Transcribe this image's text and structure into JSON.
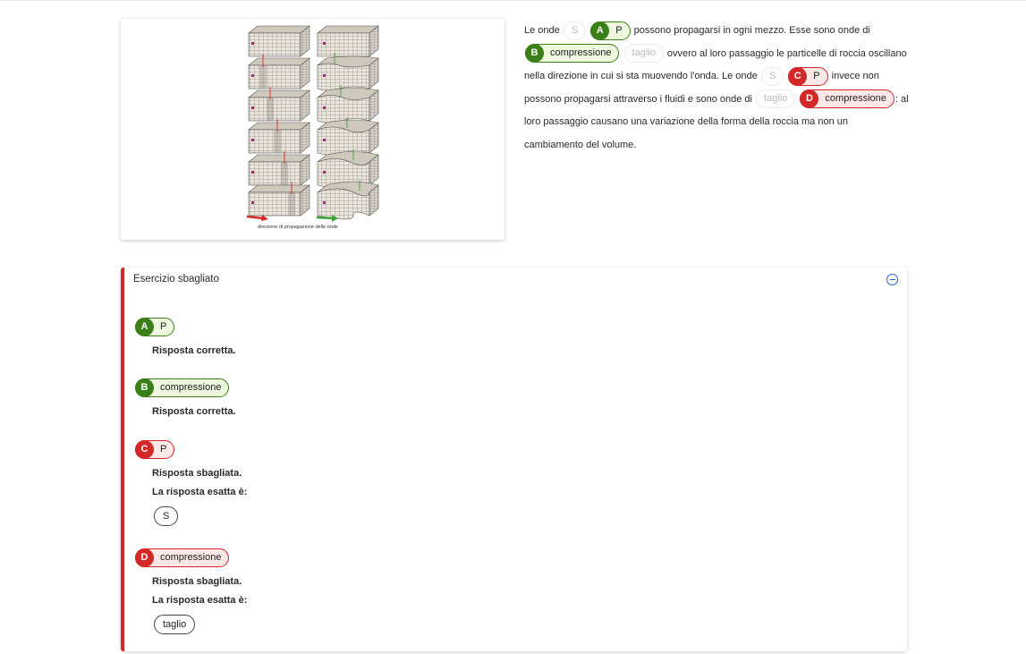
{
  "figure": {
    "caption": "direzione di propagazione delle onde",
    "colors": {
      "p_arrow": "#d42727",
      "s_arrow": "#3aa43a",
      "marker": "#c0188c"
    }
  },
  "paragraph": {
    "t1": "Le onde",
    "t2": "possono propagarsi in ogni mezzo. Esse sono onde di",
    "t3": "ovvero al loro passaggio le particelle di roccia oscillano nella direzione in cui si sta muovendo l'onda. Le onde",
    "t4": "invece non possono propagarsi attraverso i fluidi e sono onde di",
    "t5": ": al loro passaggio causano una variazione della forma della roccia ma non un cambiamento del volume.",
    "opt_s1": "S",
    "opt_taglio1": "taglio",
    "opt_s2": "S",
    "opt_taglio2": "taglio"
  },
  "answers": {
    "A": {
      "letter": "A",
      "value": "P",
      "status": "correct"
    },
    "B": {
      "letter": "B",
      "value": "compressione",
      "status": "correct"
    },
    "C": {
      "letter": "C",
      "value": "P",
      "status": "wrong",
      "correct_value": "S"
    },
    "D": {
      "letter": "D",
      "value": "compressione",
      "status": "wrong",
      "correct_value": "taglio"
    }
  },
  "panel": {
    "title": "Esercizio sbagliato",
    "correct_msg": "Risposta corretta.",
    "wrong_msg": "Risposta sbagliata.",
    "expected_label": "La risposta esatta è:",
    "accent_color": "#d42727",
    "collapse_icon": "minus-circle-icon"
  },
  "colors": {
    "correct": "#3b7f18",
    "correct_bg": "#eef8df",
    "wrong": "#d42727",
    "wrong_bg": "#fde8e8",
    "link": "#1f63c6"
  }
}
